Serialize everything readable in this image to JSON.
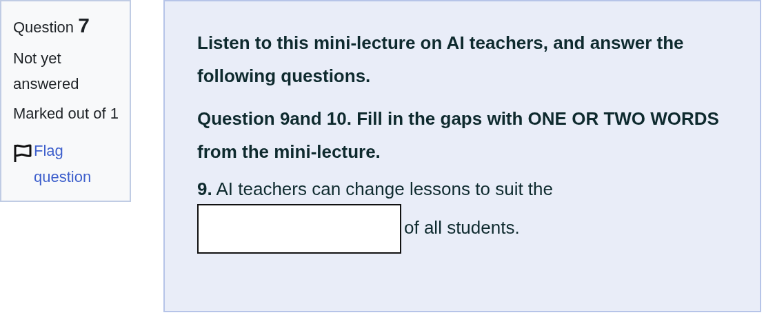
{
  "info": {
    "question_label": "Question",
    "question_number": "7",
    "status": "Not yet answered",
    "marks": "Marked out of 1",
    "flag_link": "Flag question"
  },
  "content": {
    "paragraphs": [
      "Listen to this mini-lecture on AI teachers, and answer the following questions.",
      "Question 9and 10. Fill in the gaps with ONE OR TWO WORDS from the mini-lecture."
    ],
    "item": {
      "before": "**9.** AI teachers can change lessons to suit the",
      "after": "of all students."
    }
  }
}
